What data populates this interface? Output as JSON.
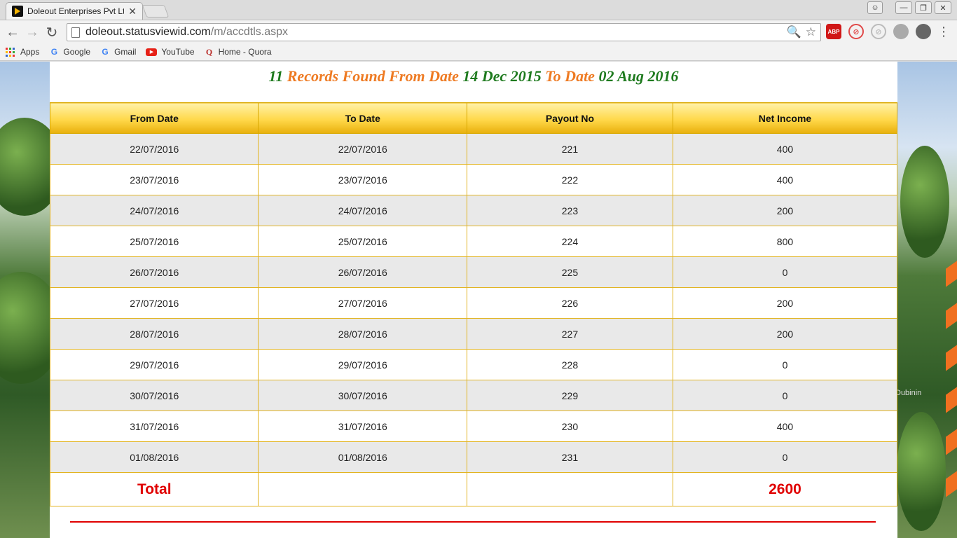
{
  "browser": {
    "tab_title": "Doleout Enterprises Pvt Lt",
    "url_host": "doleout.statusviewid.com",
    "url_path": "/m/accdtls.aspx",
    "bookmarks": [
      {
        "label": "Apps",
        "icon": "apps-icon"
      },
      {
        "label": "Google",
        "icon": "google-icon"
      },
      {
        "label": "Gmail",
        "icon": "google-icon"
      },
      {
        "label": "YouTube",
        "icon": "youtube-icon"
      },
      {
        "label": "Home - Quora",
        "icon": "quora-icon"
      }
    ],
    "extensions": [
      "ABP"
    ]
  },
  "header": {
    "count": "11",
    "part1": "Records Found From Date",
    "from_date": "14 Dec 2015",
    "part2": "To Date",
    "to_date": "02 Aug 2016",
    "colors": {
      "green": "#1e7a1e",
      "orange": "#ee7a22"
    }
  },
  "table": {
    "columns": [
      "From Date",
      "To Date",
      "Payout No",
      "Net Income"
    ],
    "rows": [
      [
        "22/07/2016",
        "22/07/2016",
        "221",
        "400"
      ],
      [
        "23/07/2016",
        "23/07/2016",
        "222",
        "400"
      ],
      [
        "24/07/2016",
        "24/07/2016",
        "223",
        "200"
      ],
      [
        "25/07/2016",
        "25/07/2016",
        "224",
        "800"
      ],
      [
        "26/07/2016",
        "26/07/2016",
        "225",
        "0"
      ],
      [
        "27/07/2016",
        "27/07/2016",
        "226",
        "200"
      ],
      [
        "28/07/2016",
        "28/07/2016",
        "227",
        "200"
      ],
      [
        "29/07/2016",
        "29/07/2016",
        "228",
        "0"
      ],
      [
        "30/07/2016",
        "30/07/2016",
        "229",
        "0"
      ],
      [
        "31/07/2016",
        "31/07/2016",
        "230",
        "400"
      ],
      [
        "01/08/2016",
        "01/08/2016",
        "231",
        "0"
      ]
    ],
    "total_label": "Total",
    "total_value": "2600"
  },
  "background_credit": "Dubinin"
}
